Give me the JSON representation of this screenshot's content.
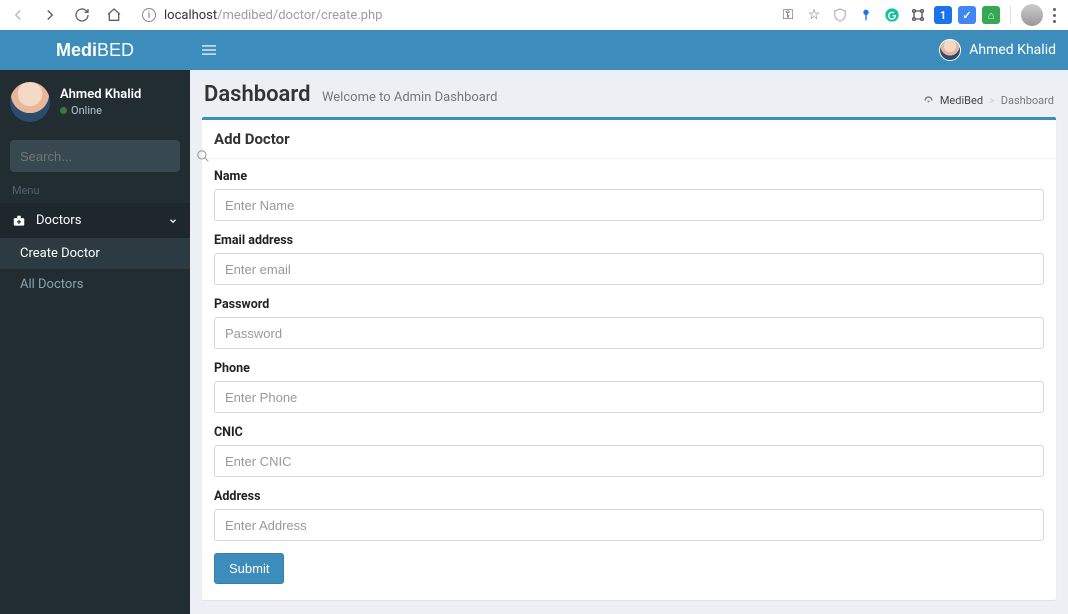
{
  "browser": {
    "url_bold": "localhost",
    "url_rest": "/medibed/doctor/create.php"
  },
  "logo": {
    "bold": "Medi",
    "thin": "BED"
  },
  "topbar": {
    "username": "Ahmed Khalid"
  },
  "sidebar": {
    "user_name": "Ahmed Khalid",
    "status": "Online",
    "search_placeholder": "Search...",
    "menu_header": "Menu",
    "tree_label": "Doctors",
    "sub_items": [
      "Create Doctor",
      "All Doctors"
    ],
    "active_index": 0
  },
  "header": {
    "title": "Dashboard",
    "subtitle": "Welcome to Admin Dashboard"
  },
  "breadcrumb": {
    "root": "MediBed",
    "current": "Dashboard"
  },
  "box": {
    "title": "Add Doctor"
  },
  "form": {
    "fields": [
      {
        "label": "Name",
        "placeholder": "Enter Name",
        "type": "text"
      },
      {
        "label": "Email address",
        "placeholder": "Enter email",
        "type": "email"
      },
      {
        "label": "Password",
        "placeholder": "Password",
        "type": "password"
      },
      {
        "label": "Phone",
        "placeholder": "Enter Phone",
        "type": "text"
      },
      {
        "label": "CNIC",
        "placeholder": "Enter CNIC",
        "type": "text"
      },
      {
        "label": "Address",
        "placeholder": "Enter Address",
        "type": "text"
      }
    ],
    "submit_label": "Submit"
  }
}
